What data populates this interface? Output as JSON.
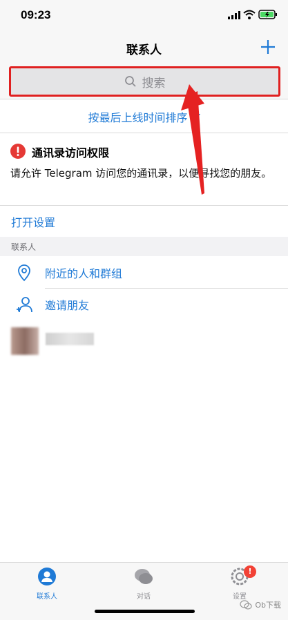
{
  "status_bar": {
    "time": "09:23"
  },
  "nav": {
    "title": "联系人",
    "add_icon": "plus-icon"
  },
  "search": {
    "placeholder": "搜索",
    "icon": "search-icon"
  },
  "sort": {
    "label": "按最后上线时间排序"
  },
  "permission": {
    "title": "通讯录访问权限",
    "description": "请允许 Telegram 访问您的通讯录，以便寻找您的朋友。",
    "action": "打开设置"
  },
  "section": {
    "header": "联系人"
  },
  "rows": [
    {
      "label": "附近的人和群组",
      "icon": "location-pin-icon"
    },
    {
      "label": "邀请朋友",
      "icon": "add-person-icon"
    }
  ],
  "tabs": [
    {
      "label": "联系人",
      "icon": "person-icon",
      "active": true
    },
    {
      "label": "对话",
      "icon": "chat-bubbles-icon",
      "active": false
    },
    {
      "label": "设置",
      "icon": "gear-icon",
      "active": false,
      "badge": "!"
    }
  ],
  "watermark": {
    "text": "Ob下载"
  },
  "colors": {
    "accent": "#1f7ad6",
    "highlight": "#e02020",
    "badge": "#f24236"
  }
}
